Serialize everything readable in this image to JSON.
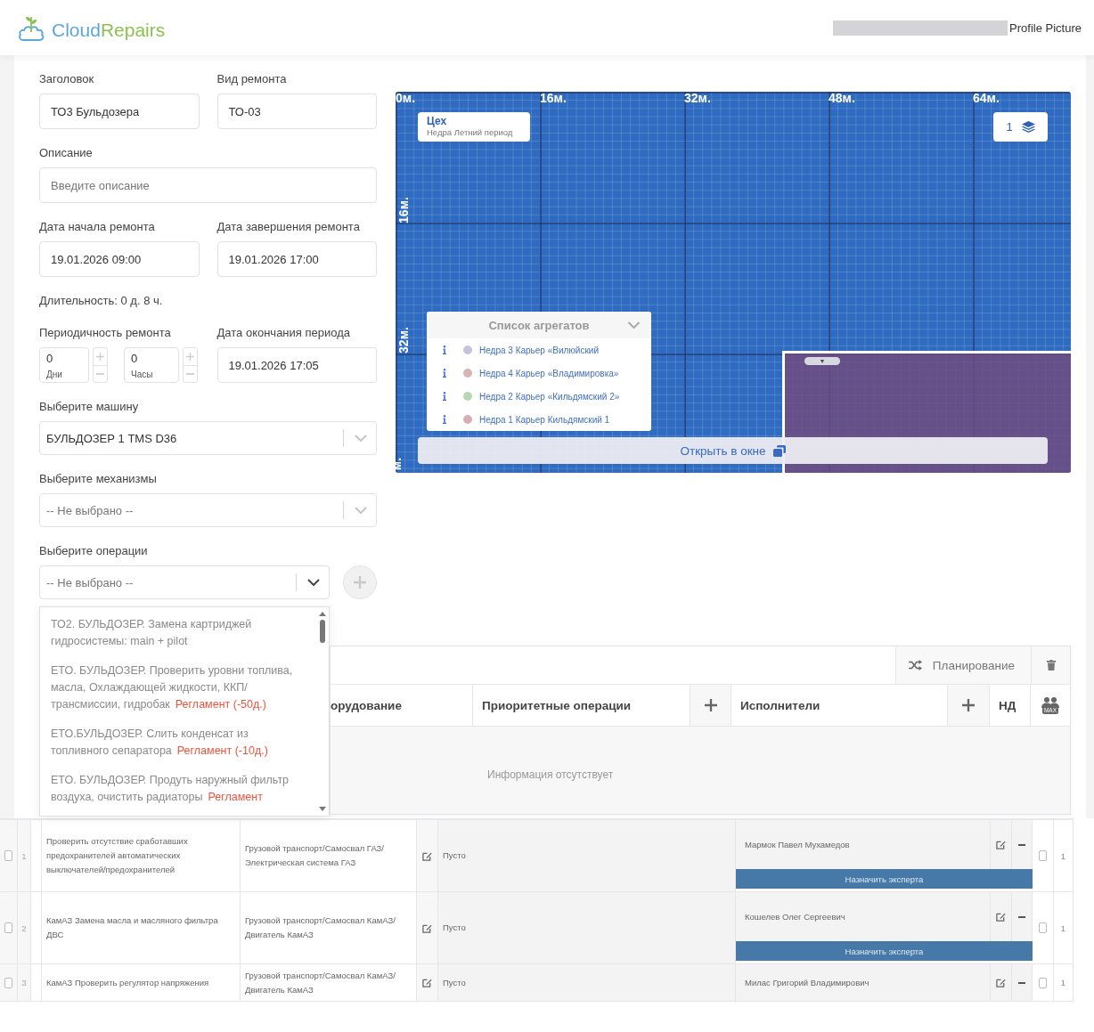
{
  "header": {
    "logo_text_parts": [
      "Cloud",
      "Repairs"
    ],
    "profile_image_alt": "Profile Picture"
  },
  "form": {
    "title": {
      "label": "Заголовок",
      "value": "ТО3 Бульдозера"
    },
    "repair_type": {
      "label": "Вид ремонта",
      "value": "ТО-03"
    },
    "description": {
      "label": "Описание",
      "placeholder": "Введите описание"
    },
    "start_date": {
      "label": "Дата начала ремонта",
      "value": "19.01.2026 09:00"
    },
    "end_date": {
      "label": "Дата завершения ремонта",
      "value": "19.01.2026 17:00"
    },
    "duration": "Длительность: 0 д. 8 ч.",
    "periodicity": {
      "label": "Периодичность ремонта",
      "fields": [
        {
          "value": "0",
          "unit": "Дни"
        },
        {
          "value": "0",
          "unit": "Часы"
        }
      ]
    },
    "period_end": {
      "label": "Дата окончания периода",
      "value": "19.01.2026 17:05"
    },
    "machine": {
      "label": "Выберите машину",
      "value": "БУЛЬДОЗЕР 1 TMS D36"
    },
    "mechanisms": {
      "label": "Выберите механизмы",
      "placeholder": "-- Не выбрано --"
    },
    "operations": {
      "label": "Выберите операции",
      "placeholder": "-- Не выбрано --",
      "expanded": true,
      "options": [
        {
          "text": "ТО2. БУЛЬДОЗЕР. Замена картриджей гидросистемы: main + pilot"
        },
        {
          "text": "ЕТО. БУЛЬДОЗЕР. Проверить уровни топлива, масла, Охлаждающей жидкости, ККП/трансмиссии, гидробак",
          "tag": "Регламент (-50д.)"
        },
        {
          "text": "ЕТО.БУЛЬДОЗЕР. Слить конденсат из топливного сепаратора",
          "tag": "Регламент (-10д.)"
        },
        {
          "text": "ЕТО. БУЛЬДОЗЕР. Продуть наружный фильтр воздуха, очистить радиаторы",
          "tag": "Регламент"
        }
      ]
    }
  },
  "map": {
    "x_ticks": [
      "0м.",
      "16м.",
      "32м.",
      "48м.",
      "64м."
    ],
    "y_ticks": [
      "16м.",
      "32м.",
      "м."
    ],
    "location": {
      "title": "Цех",
      "subtitle": "Недра Летний период"
    },
    "layers_count": "1",
    "zone_handle": "▼",
    "aggregates": {
      "title": "Список агрегатов",
      "items": [
        {
          "name": "Недра 3 Карьер «Вилюйский",
          "color": "#c5c3d9"
        },
        {
          "name": "Недра 4 Карьер «Владимировка»",
          "color": "#dab3b3"
        },
        {
          "name": "Недра 2 Карьер «Кильдямский 2»",
          "color": "#b7d9b1"
        },
        {
          "name": "Недра 1 Карьер Кильдямский 1",
          "color": "#d9adb6"
        }
      ]
    },
    "open_window": "Открыть в окне"
  },
  "tasks": {
    "planning_button": "Планирование",
    "columns": [
      {
        "kind": "text",
        "label": "орудование"
      },
      {
        "kind": "text",
        "label": "Приоритетные операции"
      },
      {
        "kind": "add"
      },
      {
        "kind": "text",
        "label": "Исполнители"
      },
      {
        "kind": "add"
      },
      {
        "kind": "text",
        "label": "НД"
      },
      {
        "kind": "max",
        "badge": "MAX"
      }
    ],
    "empty_text": "Информация отсутствует"
  },
  "rows": [
    {
      "checked": false,
      "number": "1",
      "operation": "Проверить отсутствие сработавших предохранителей автоматических выключателей/предохранителей",
      "equipment": "Грузовой транспорт/Самосвал ГАЗ/Электрическая система ГАЗ",
      "field": "Пусто",
      "executor": "Мармок Павел Мухамедов",
      "expert_button": "Назначить эксперта",
      "executor_checked": false,
      "count": "1"
    },
    {
      "checked": false,
      "number": "2",
      "operation": "КамАЗ Замена масла и масляного фильтра ДВС",
      "equipment": "Грузовой транспорт/Самосвал КамАЗ/Двигатель КамАЗ",
      "field": "Пусто",
      "executor": "Кошелев Олег Сергеевич",
      "expert_button": "Назначить эксперта",
      "executor_checked": false,
      "count": "1"
    },
    {
      "checked": false,
      "number": "3",
      "operation": "КамАЗ Проверить регулятор напряжения",
      "equipment": "Грузовой транспорт/Самосвал КамАЗ/Двигатель КамАЗ",
      "field": "Пусто",
      "executor": "Милас Григорий Владимирович",
      "executor_checked": false,
      "count": "1"
    }
  ]
}
